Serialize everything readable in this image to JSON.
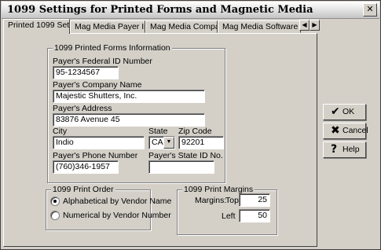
{
  "window": {
    "title": "1099 Settings for Printed Forms and Magnetic Media",
    "close_glyph": "✕"
  },
  "tabs": [
    {
      "label": "Printed 1099 Settings",
      "active": true
    },
    {
      "label": "Mag Media Payer Info",
      "active": false
    },
    {
      "label": "Mag Media Company Info",
      "active": false
    },
    {
      "label": "Mag Media Software Vend",
      "active": false
    }
  ],
  "tab_scroll": {
    "left_icon": "arrow-left-icon",
    "left_glyph": "◀",
    "right_icon": "arrow-right-icon",
    "right_glyph": "▶"
  },
  "printed_forms": {
    "group_title": "1099 Printed Forms Information",
    "payer_federal_id": {
      "label": "Payer's Federal ID Number",
      "value": "95-1234567"
    },
    "payer_company_name": {
      "label": "Payer's Company Name",
      "value": "Majestic Shutters, Inc."
    },
    "payer_address": {
      "label": "Payer's Address",
      "value": "83876 Avenue 45"
    },
    "city": {
      "label": "City",
      "value": "Indio"
    },
    "state": {
      "label": "State",
      "value": "CA",
      "dropdown_glyph": "▼"
    },
    "zip": {
      "label": "Zip Code",
      "value": "92201"
    },
    "phone": {
      "label": "Payer's Phone Number",
      "value": "(760)346-1957"
    },
    "state_id": {
      "label": "Payer's State ID No.",
      "value": ""
    }
  },
  "print_order": {
    "group_title": "1099 Print Order",
    "options": [
      {
        "label": "Alphabetical by Vendor Name",
        "checked": true
      },
      {
        "label": "Numerical by Vendor Number",
        "checked": false
      }
    ]
  },
  "print_margins": {
    "group_title": "1099 Print Margins",
    "margins_label": "Margins:",
    "top_label": "Top",
    "top_value": "25",
    "left_label": "Left",
    "left_value": "50"
  },
  "buttons": {
    "ok": {
      "label": "OK",
      "icon": "checkmark-icon",
      "glyph": "✔",
      "color": "#000000"
    },
    "cancel": {
      "label": "Cancel",
      "icon": "x-mark-icon",
      "glyph": "✖",
      "color": "#000000"
    },
    "help": {
      "label": "Help",
      "icon": "question-mark-icon",
      "glyph": "?",
      "color": "#000000"
    }
  }
}
